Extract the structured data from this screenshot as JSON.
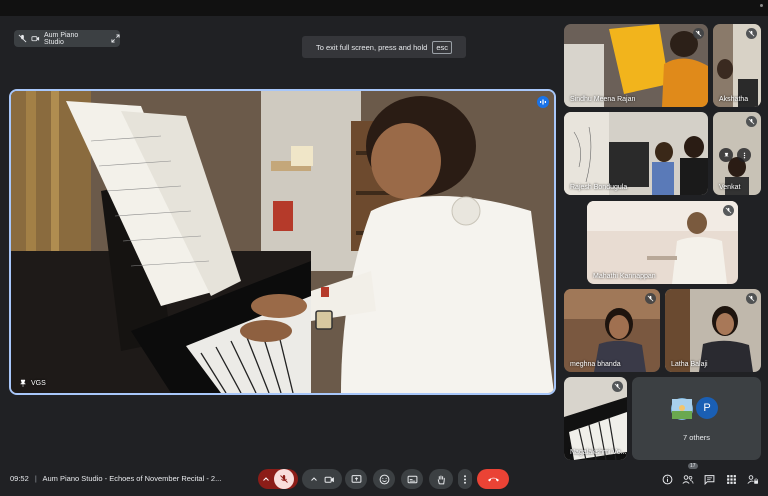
{
  "studio_pill": {
    "label": "Aum Piano Studio"
  },
  "exit_banner": {
    "text": "To exit full screen, press and hold",
    "key": "esc"
  },
  "main_speaker": {
    "name": "VGS"
  },
  "participants": [
    {
      "name": "Sindhu Meena Rajan"
    },
    {
      "name": "Akshatha"
    },
    {
      "name": "Rajesh Bondugula"
    },
    {
      "name": "Venkat"
    },
    {
      "name": "Mahathi Kannappan"
    },
    {
      "name": "meghna bhanda"
    },
    {
      "name": "Latha Balaji"
    },
    {
      "name": "Nagalakshmi Ve..."
    }
  ],
  "others_tile": {
    "label": "7 others",
    "avatar_letter": "P"
  },
  "bottom_bar": {
    "time": "09:52",
    "separator": "|",
    "meeting_title": "Aum Piano Studio - Echoes of November Recital - 2...",
    "participant_count": "17"
  },
  "colors": {
    "background": "#202124",
    "tile": "#3c4043",
    "active_border": "#a8c7fa",
    "end_call": "#ea4335",
    "mic_off_bg": "#8c1d18",
    "avatar_blue": "#1a5fb4"
  },
  "icons": {
    "mic_off": "mic-off-icon",
    "camera": "camera-icon",
    "present": "present-icon",
    "emoji": "emoji-icon",
    "captions": "captions-icon",
    "hand": "raise-hand-icon",
    "more": "more-vert-icon",
    "end_call": "end-call-icon",
    "info": "info-icon",
    "people": "people-icon",
    "chat": "chat-icon",
    "activities": "activities-icon",
    "host_controls": "lock-person-icon"
  }
}
